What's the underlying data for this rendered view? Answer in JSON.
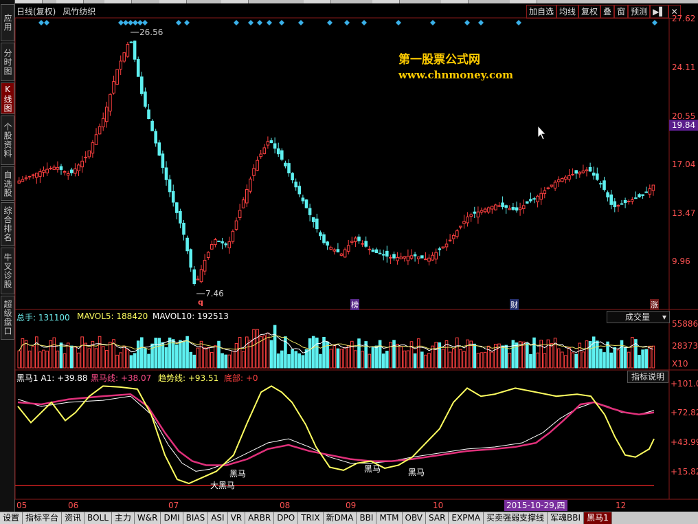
{
  "nav": {
    "items": [
      "应用",
      "分时图",
      "K线图",
      "个股资料",
      "自选股",
      "综合排名",
      "牛叉诊股",
      "超级盘口"
    ],
    "active": 2
  },
  "header": {
    "title": "日线(复权)",
    "stock": "凤竹纺织"
  },
  "toolbar": [
    "加自选",
    "均线",
    "复权",
    "叠",
    "窗",
    "预测",
    "▶▌",
    "✕"
  ],
  "price_axis": [
    "27.62",
    "24.11",
    "20.55",
    "17.04",
    "13.47",
    "9.96"
  ],
  "current_price": "19.84",
  "annotations": {
    "high": "26.56",
    "low": "7.46",
    "marks": [
      "q",
      "榜",
      "财",
      "涨"
    ]
  },
  "watermark": {
    "line1": "第一股票公式网",
    "line2": "www.chnmoney.com"
  },
  "volume_panel": {
    "label1": "总手: 131100",
    "label2": "MAVOL5: 188420",
    "label3": "MAVOL10: 192513",
    "axis": [
      "55886",
      "28373",
      "X10"
    ],
    "select": "成交量"
  },
  "indicator_panel": {
    "label_a": "黑马1 A1: +39.88",
    "label_b": "黑马线: +38.07",
    "label_c": "趋势线: +93.51",
    "label_d": "底部: +0",
    "axis": [
      "+101.0",
      "+72.82",
      "+43.99",
      "+15.82"
    ],
    "explain": "指标说明",
    "signals": [
      "黑马",
      "大黑马",
      "黑马",
      "黑马"
    ]
  },
  "dates": [
    "05",
    "06",
    "07",
    "08",
    "09",
    "10",
    "12"
  ],
  "date_highlight": "2015-10-29,四",
  "bottom_tabs": [
    "设置",
    "指标平台",
    "资讯",
    "BOLL",
    "主力",
    "W&R",
    "DMI",
    "BIAS",
    "ASI",
    "VR",
    "ARBR",
    "DPO",
    "TRIX",
    "新DMA",
    "BBI",
    "MTM",
    "OBV",
    "SAR",
    "EXPMA",
    "买卖强弱支撑线",
    "军魂BBI",
    "黑马1"
  ],
  "bottom_tab_active": 21,
  "colors": {
    "up": "#ff4040",
    "down": "#5ef0f0",
    "axis": "#ff5252",
    "yellow": "#ffff60",
    "magenta": "#e0307a"
  }
}
